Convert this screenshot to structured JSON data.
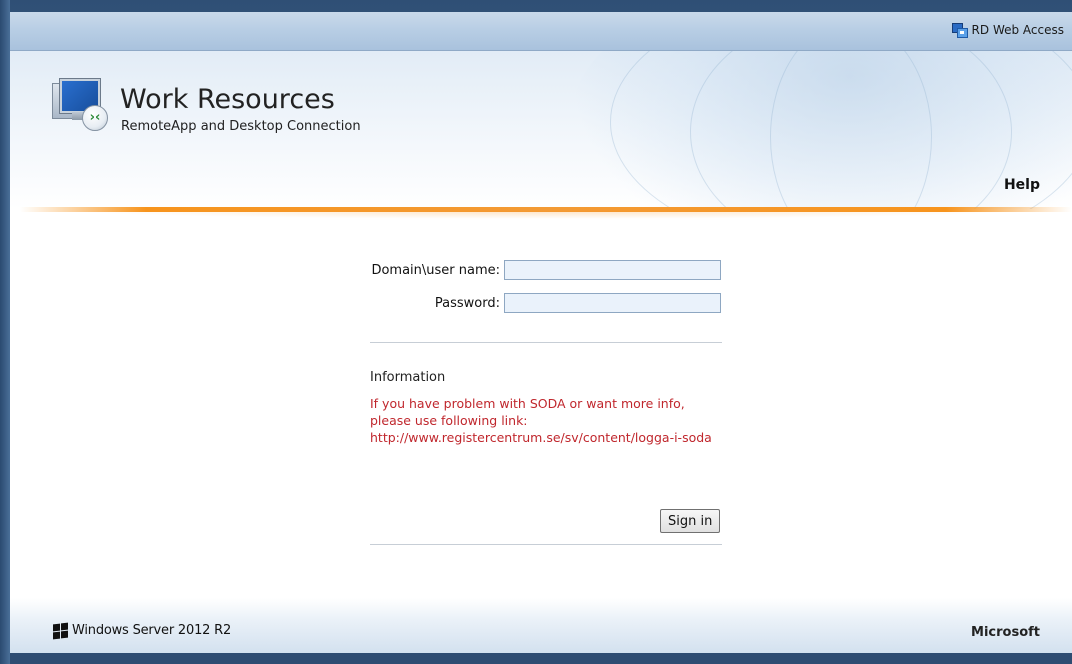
{
  "header": {
    "rd_web_access_label": "RD Web Access",
    "rd_web_access_icon": "rd-web-access-icon"
  },
  "banner": {
    "title": "Work Resources",
    "subtitle": "RemoteApp and Desktop Connection",
    "help_label": "Help",
    "app_icon": "remote-desktop-icon"
  },
  "login": {
    "username_label": "Domain\\user name:",
    "username_value": "",
    "password_label": "Password:",
    "password_value": "",
    "info_heading": "Information",
    "info_lines": [
      "If you have problem with SODA or want more info,",
      "please use following link:",
      "http://www.registercentrum.se/sv/content/logga-i-soda"
    ],
    "signin_label": "Sign in"
  },
  "footer": {
    "product": "Windows Server 2012 R2",
    "vendor": "Microsoft",
    "windows_icon": "windows-logo-icon"
  },
  "colors": {
    "accent_orange": "#f7941d",
    "info_red": "#c0272d",
    "topbar_blue": "#b7cde4"
  }
}
